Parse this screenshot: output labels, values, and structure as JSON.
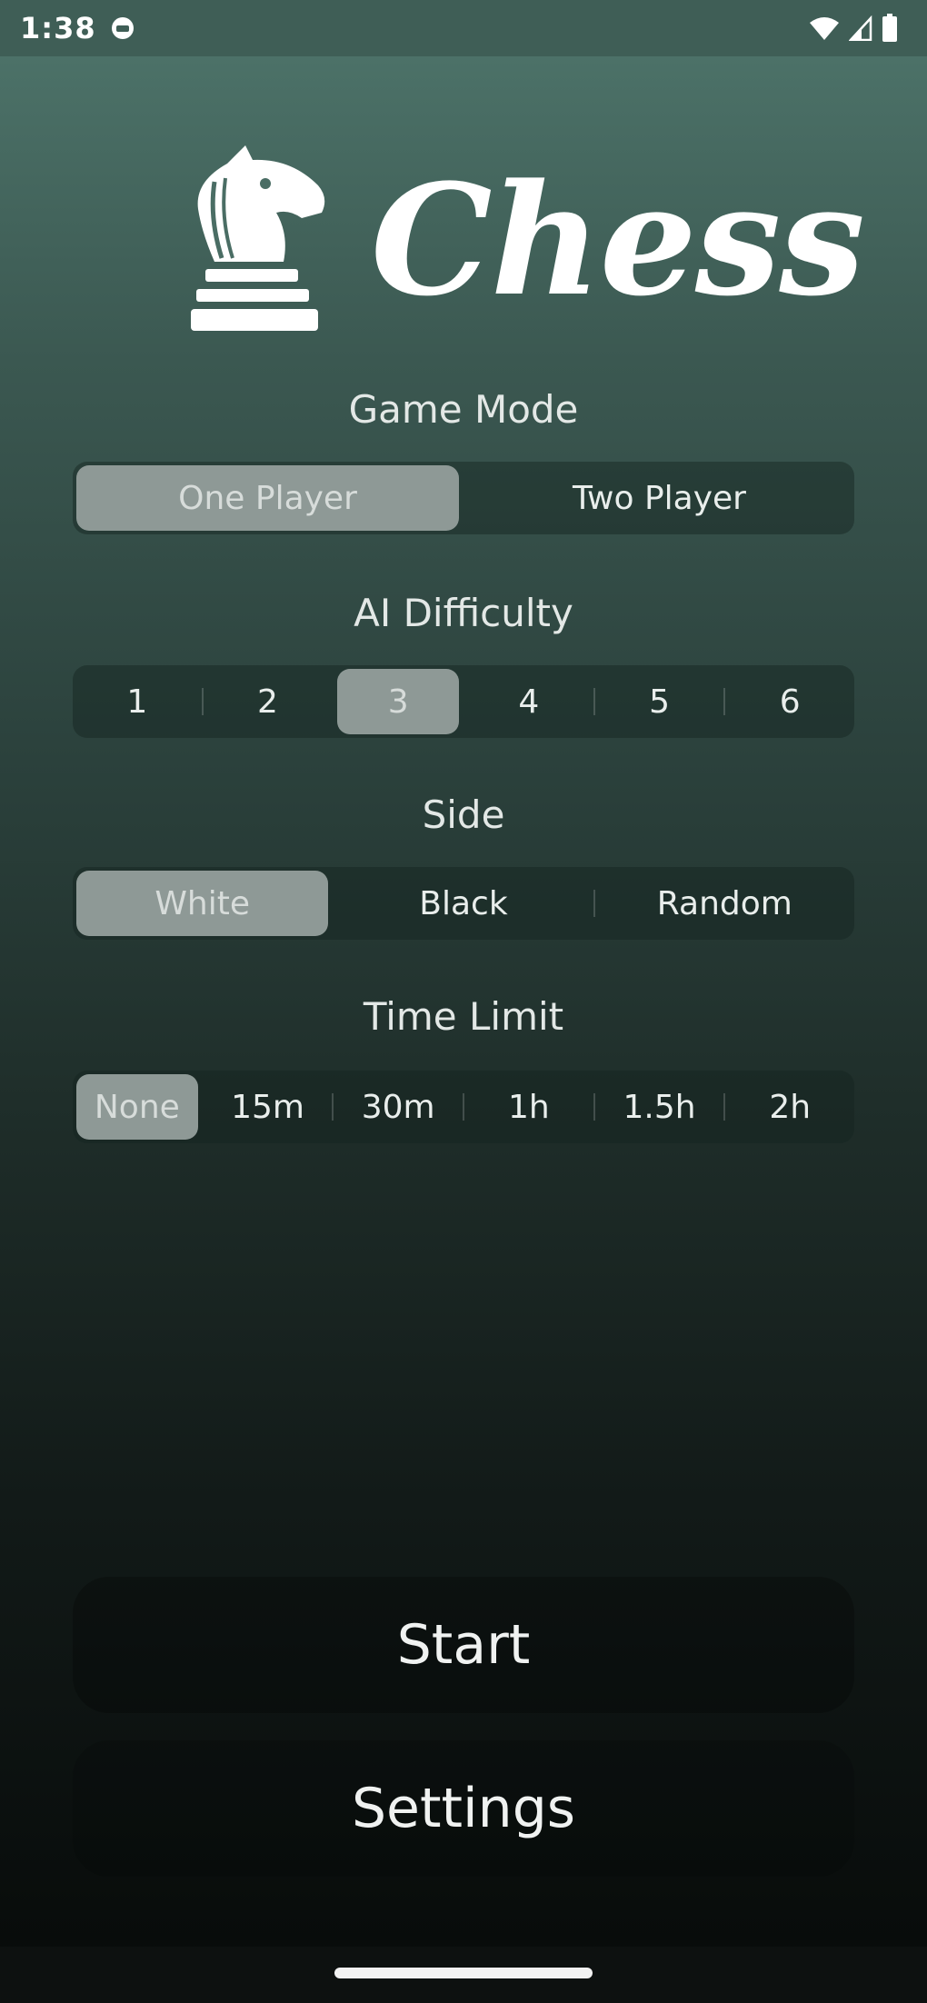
{
  "status_bar": {
    "time": "1:38"
  },
  "app": {
    "title": "Chess"
  },
  "game_mode": {
    "title": "Game Mode",
    "options": [
      "One Player",
      "Two Player"
    ],
    "selected": "One Player"
  },
  "ai_difficulty": {
    "title": "AI Difficulty",
    "options": [
      "1",
      "2",
      "3",
      "4",
      "5",
      "6"
    ],
    "selected": "3"
  },
  "side": {
    "title": "Side",
    "options": [
      "White",
      "Black",
      "Random"
    ],
    "selected": "White"
  },
  "time_limit": {
    "title": "Time Limit",
    "options": [
      "None",
      "15m",
      "30m",
      "1h",
      "1.5h",
      "2h"
    ],
    "selected": "None"
  },
  "actions": {
    "start_label": "Start",
    "settings_label": "Settings"
  },
  "icons": {
    "logo": "knight-icon",
    "status_app": "app-notification-icon",
    "wifi": "wifi-icon",
    "signal": "cell-signal-icon",
    "battery": "battery-icon"
  }
}
